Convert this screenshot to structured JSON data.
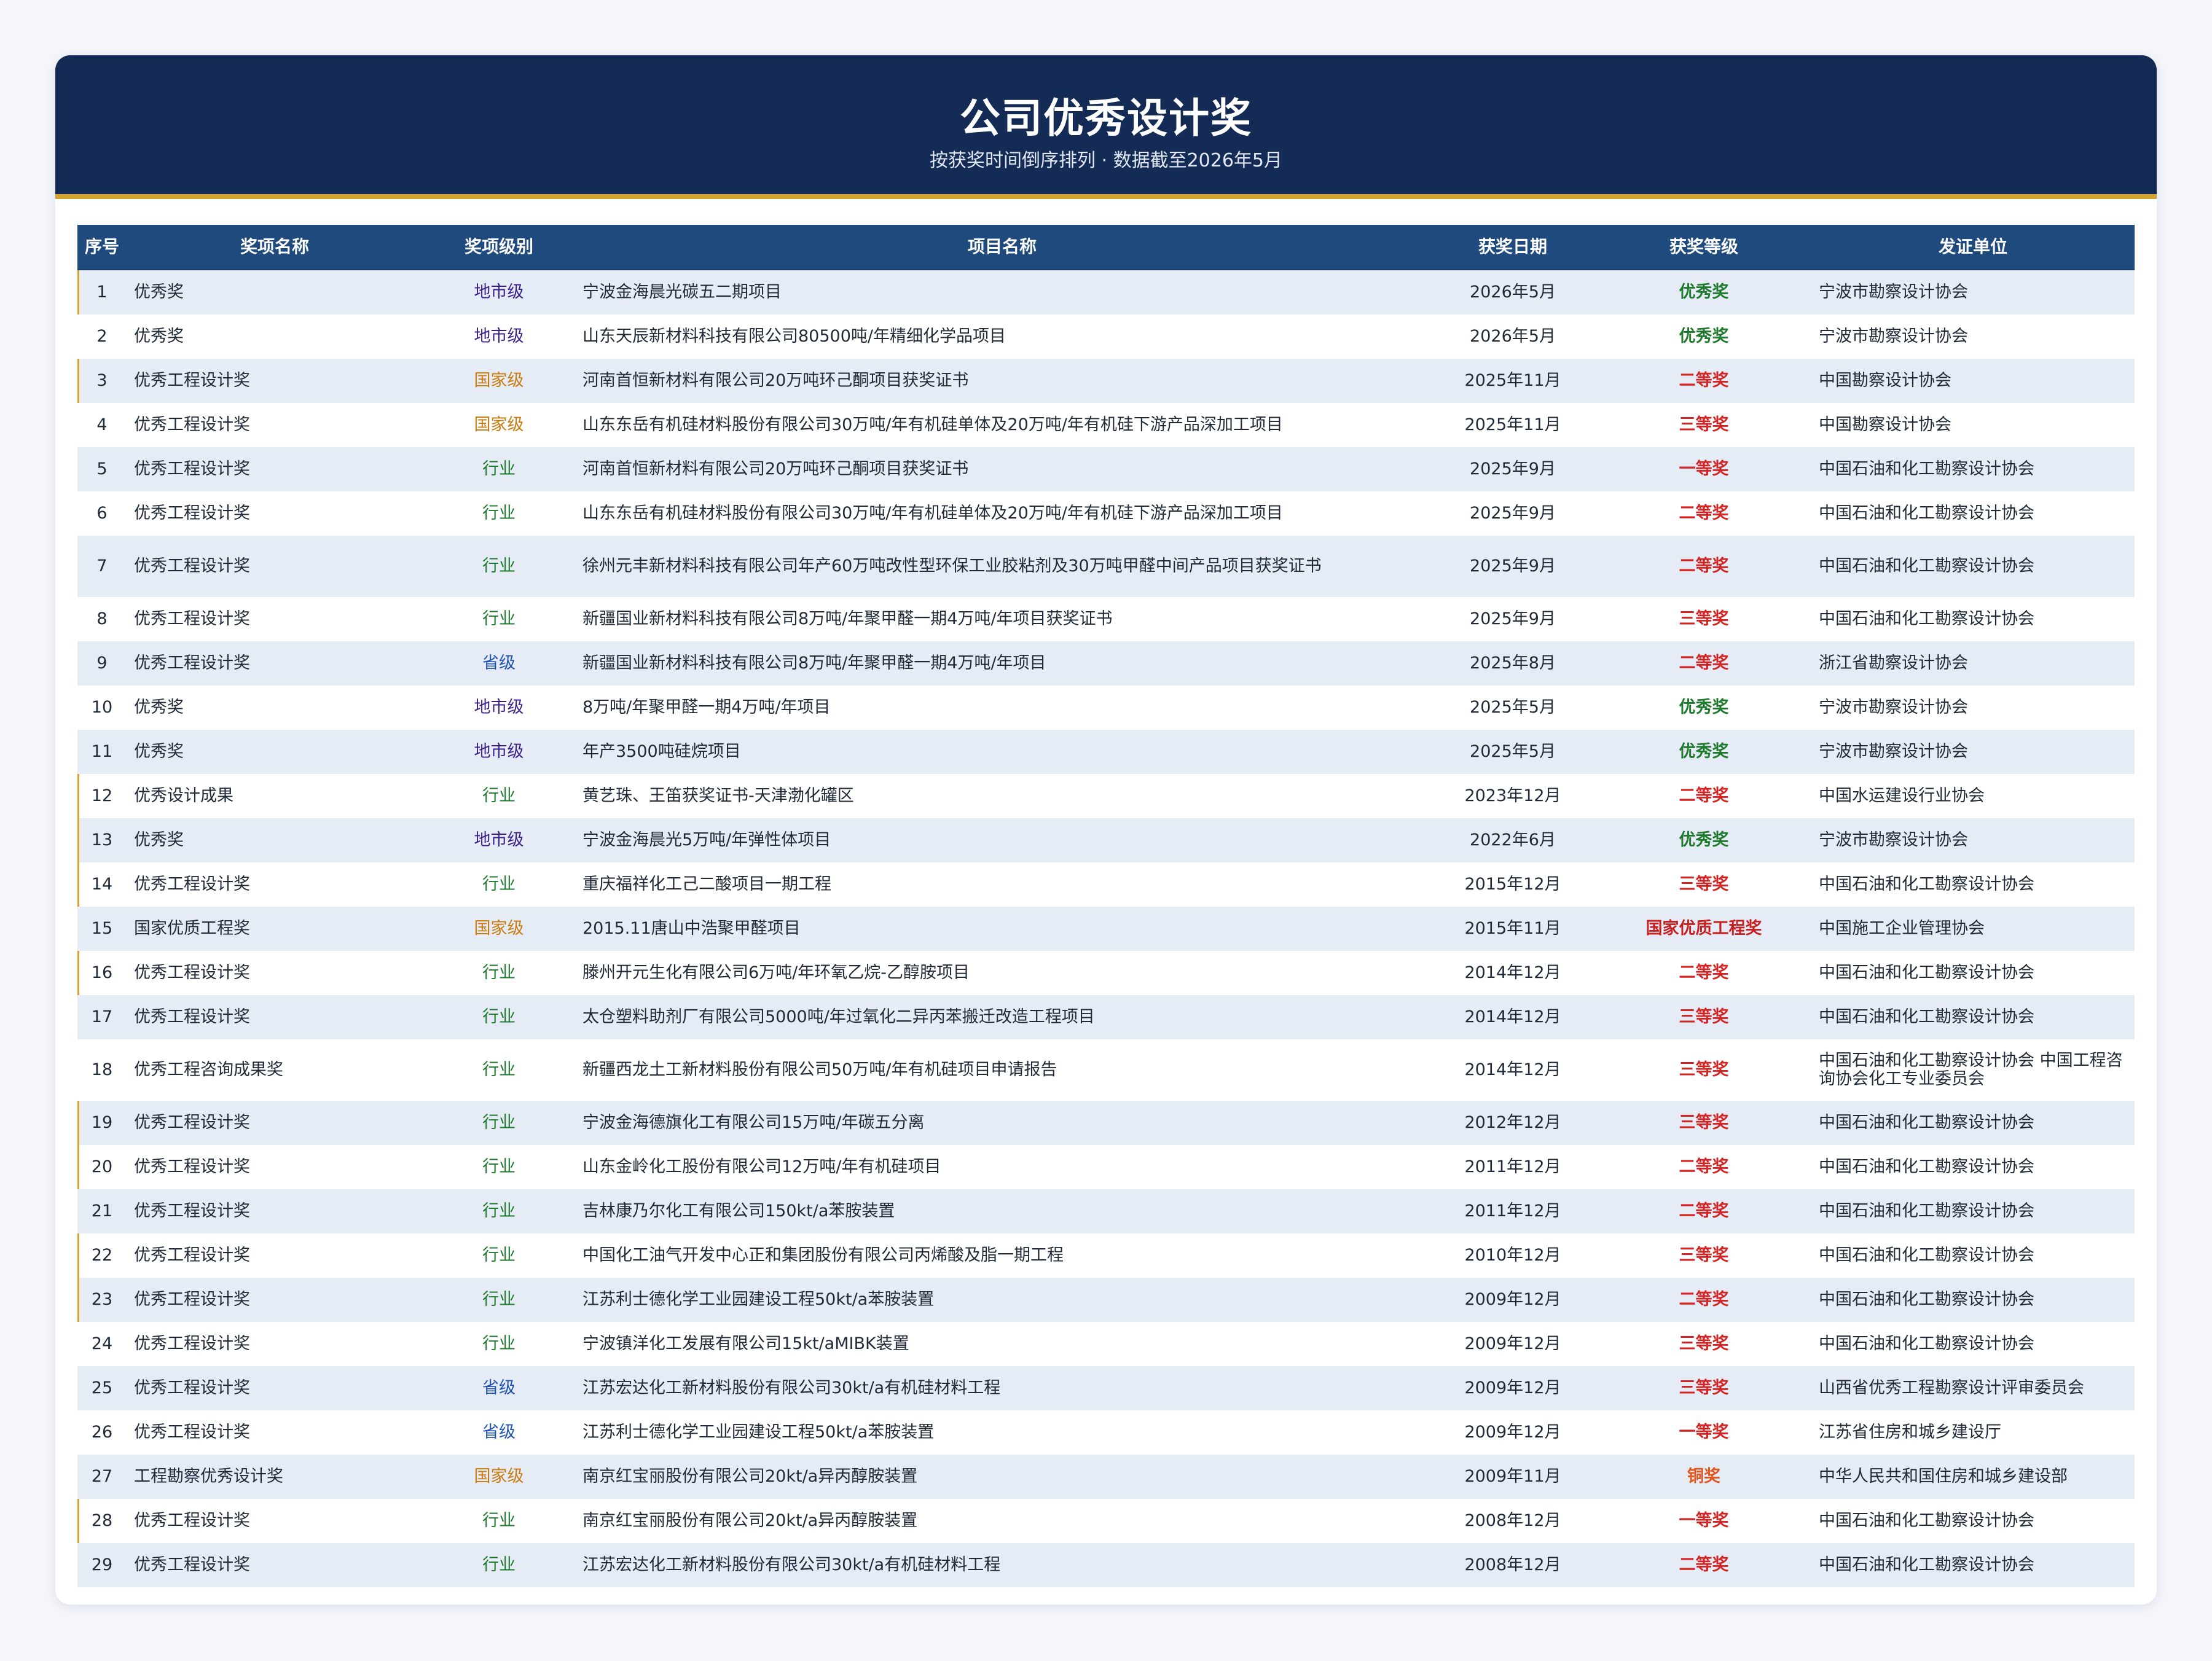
{
  "header": {
    "title": "公司优秀设计奖",
    "subtitle": "按获奖时间倒序排列 · 数据截至2026年5月"
  },
  "columns": [
    "序号",
    "奖项名称",
    "奖项级别",
    "项目名称",
    "获奖日期",
    "获奖等级",
    "发证单位"
  ],
  "rows": [
    {
      "no": "1",
      "award": "优秀奖",
      "level": "地市级",
      "project": "宁波金海晨光碳五二期项目",
      "date": "2026年5月",
      "grade": "优秀奖",
      "issuer": "宁波市勘察设计协会"
    },
    {
      "no": "2",
      "award": "优秀奖",
      "level": "地市级",
      "project": "山东天辰新材料科技有限公司80500吨/年精细化学品项目",
      "date": "2026年5月",
      "grade": "优秀奖",
      "issuer": "宁波市勘察设计协会"
    },
    {
      "no": "3",
      "award": "优秀工程设计奖",
      "level": "国家级",
      "project": "河南首恒新材料有限公司20万吨环己酮项目获奖证书",
      "date": "2025年11月",
      "grade": "二等奖",
      "issuer": "中国勘察设计协会"
    },
    {
      "no": "4",
      "award": "优秀工程设计奖",
      "level": "国家级",
      "project": "山东东岳有机硅材料股份有限公司30万吨/年有机硅单体及20万吨/年有机硅下游产品深加工项目",
      "date": "2025年11月",
      "grade": "三等奖",
      "issuer": "中国勘察设计协会"
    },
    {
      "no": "5",
      "award": "优秀工程设计奖",
      "level": "行业",
      "project": "河南首恒新材料有限公司20万吨环己酮项目获奖证书",
      "date": "2025年9月",
      "grade": "一等奖",
      "issuer": "中国石油和化工勘察设计协会"
    },
    {
      "no": "6",
      "award": "优秀工程设计奖",
      "level": "行业",
      "project": "山东东岳有机硅材料股份有限公司30万吨/年有机硅单体及20万吨/年有机硅下游产品深加工项目",
      "date": "2025年9月",
      "grade": "二等奖",
      "issuer": "中国石油和化工勘察设计协会"
    },
    {
      "no": "7",
      "award": "优秀工程设计奖",
      "level": "行业",
      "project": "徐州元丰新材料科技有限公司年产60万吨改性型环保工业胶粘剂及30万吨甲醛中间产品项目获奖证书",
      "date": "2025年9月",
      "grade": "二等奖",
      "issuer": "中国石油和化工勘察设计协会"
    },
    {
      "no": "8",
      "award": "优秀工程设计奖",
      "level": "行业",
      "project": "新疆国业新材料科技有限公司8万吨/年聚甲醛一期4万吨/年项目获奖证书",
      "date": "2025年9月",
      "grade": "三等奖",
      "issuer": "中国石油和化工勘察设计协会"
    },
    {
      "no": "9",
      "award": "优秀工程设计奖",
      "level": "省级",
      "project": "新疆国业新材料科技有限公司8万吨/年聚甲醛一期4万吨/年项目",
      "date": "2025年8月",
      "grade": "二等奖",
      "issuer": "浙江省勘察设计协会"
    },
    {
      "no": "10",
      "award": "优秀奖",
      "level": "地市级",
      "project": "8万吨/年聚甲醛一期4万吨/年项目",
      "date": "2025年5月",
      "grade": "优秀奖",
      "issuer": "宁波市勘察设计协会"
    },
    {
      "no": "11",
      "award": "优秀奖",
      "level": "地市级",
      "project": "年产3500吨硅烷项目",
      "date": "2025年5月",
      "grade": "优秀奖",
      "issuer": "宁波市勘察设计协会"
    },
    {
      "no": "12",
      "award": "优秀设计成果",
      "level": "行业",
      "project": "黄艺珠、王笛获奖证书-天津渤化罐区",
      "date": "2023年12月",
      "grade": "二等奖",
      "issuer": "中国水运建设行业协会"
    },
    {
      "no": "13",
      "award": "优秀奖",
      "level": "地市级",
      "project": "宁波金海晨光5万吨/年弹性体项目",
      "date": "2022年6月",
      "grade": "优秀奖",
      "issuer": "宁波市勘察设计协会"
    },
    {
      "no": "14",
      "award": "优秀工程设计奖",
      "level": "行业",
      "project": "重庆福祥化工己二酸项目一期工程",
      "date": "2015年12月",
      "grade": "三等奖",
      "issuer": "中国石油和化工勘察设计协会"
    },
    {
      "no": "15",
      "award": "国家优质工程奖",
      "level": "国家级",
      "project": "2015.11唐山中浩聚甲醛项目",
      "date": "2015年11月",
      "grade": "国家优质工程奖",
      "issuer": "中国施工企业管理协会"
    },
    {
      "no": "16",
      "award": "优秀工程设计奖",
      "level": "行业",
      "project": "滕州开元生化有限公司6万吨/年环氧乙烷-乙醇胺项目",
      "date": "2014年12月",
      "grade": "二等奖",
      "issuer": "中国石油和化工勘察设计协会"
    },
    {
      "no": "17",
      "award": "优秀工程设计奖",
      "level": "行业",
      "project": "太仓塑料助剂厂有限公司5000吨/年过氧化二异丙苯搬迁改造工程项目",
      "date": "2014年12月",
      "grade": "三等奖",
      "issuer": "中国石油和化工勘察设计协会"
    },
    {
      "no": "18",
      "award": "优秀工程咨询成果奖",
      "level": "行业",
      "project": "新疆西龙土工新材料股份有限公司50万吨/年有机硅项目申请报告",
      "date": "2014年12月",
      "grade": "三等奖",
      "issuer": "中国石油和化工勘察设计协会 中国工程咨询协会化工专业委员会"
    },
    {
      "no": "19",
      "award": "优秀工程设计奖",
      "level": "行业",
      "project": "宁波金海德旗化工有限公司15万吨/年碳五分离",
      "date": "2012年12月",
      "grade": "三等奖",
      "issuer": "中国石油和化工勘察设计协会"
    },
    {
      "no": "20",
      "award": "优秀工程设计奖",
      "level": "行业",
      "project": "山东金岭化工股份有限公司12万吨/年有机硅项目",
      "date": "2011年12月",
      "grade": "二等奖",
      "issuer": "中国石油和化工勘察设计协会"
    },
    {
      "no": "21",
      "award": "优秀工程设计奖",
      "level": "行业",
      "project": "吉林康乃尔化工有限公司150kt/a苯胺装置",
      "date": "2011年12月",
      "grade": "二等奖",
      "issuer": "中国石油和化工勘察设计协会"
    },
    {
      "no": "22",
      "award": "优秀工程设计奖",
      "level": "行业",
      "project": "中国化工油气开发中心正和集团股份有限公司丙烯酸及脂一期工程",
      "date": "2010年12月",
      "grade": "三等奖",
      "issuer": "中国石油和化工勘察设计协会"
    },
    {
      "no": "23",
      "award": "优秀工程设计奖",
      "level": "行业",
      "project": "江苏利士德化学工业园建设工程50kt/a苯胺装置",
      "date": "2009年12月",
      "grade": "二等奖",
      "issuer": "中国石油和化工勘察设计协会"
    },
    {
      "no": "24",
      "award": "优秀工程设计奖",
      "level": "行业",
      "project": "宁波镇洋化工发展有限公司15kt/aMIBK装置",
      "date": "2009年12月",
      "grade": "三等奖",
      "issuer": "中国石油和化工勘察设计协会"
    },
    {
      "no": "25",
      "award": "优秀工程设计奖",
      "level": "省级",
      "project": "江苏宏达化工新材料股份有限公司30kt/a有机硅材料工程",
      "date": "2009年12月",
      "grade": "三等奖",
      "issuer": "山西省优秀工程勘察设计评审委员会"
    },
    {
      "no": "26",
      "award": "优秀工程设计奖",
      "level": "省级",
      "project": "江苏利士德化学工业园建设工程50kt/a苯胺装置",
      "date": "2009年12月",
      "grade": "一等奖",
      "issuer": "江苏省住房和城乡建设厅"
    },
    {
      "no": "27",
      "award": "工程勘察优秀设计奖",
      "level": "国家级",
      "project": "南京红宝丽股份有限公司20kt/a异丙醇胺装置",
      "date": "2009年11月",
      "grade": "铜奖",
      "issuer": "中华人民共和国住房和城乡建设部"
    },
    {
      "no": "28",
      "award": "优秀工程设计奖",
      "level": "行业",
      "project": "南京红宝丽股份有限公司20kt/a异丙醇胺装置",
      "date": "2008年12月",
      "grade": "一等奖",
      "issuer": "中国石油和化工勘察设计协会"
    },
    {
      "no": "29",
      "award": "优秀工程设计奖",
      "level": "行业",
      "project": "江苏宏达化工新材料股份有限公司30kt/a有机硅材料工程",
      "date": "2008年12月",
      "grade": "二等奖",
      "issuer": "中国石油和化工勘察设计协会"
    }
  ],
  "colors": {
    "header_bg": "#142c55",
    "accent_gold": "#d4a22e",
    "table_head_bg": "#1e4a7e",
    "row_alt_bg": "#e6ecf6",
    "level_city": "#3d1f8c",
    "level_national": "#c97b0e",
    "level_industry": "#1f7a2e",
    "level_province": "#2053b3",
    "grade_excellent": "#1f7a2e",
    "grade_ranked": "#d42424",
    "grade_bronze": "#e2561d"
  }
}
